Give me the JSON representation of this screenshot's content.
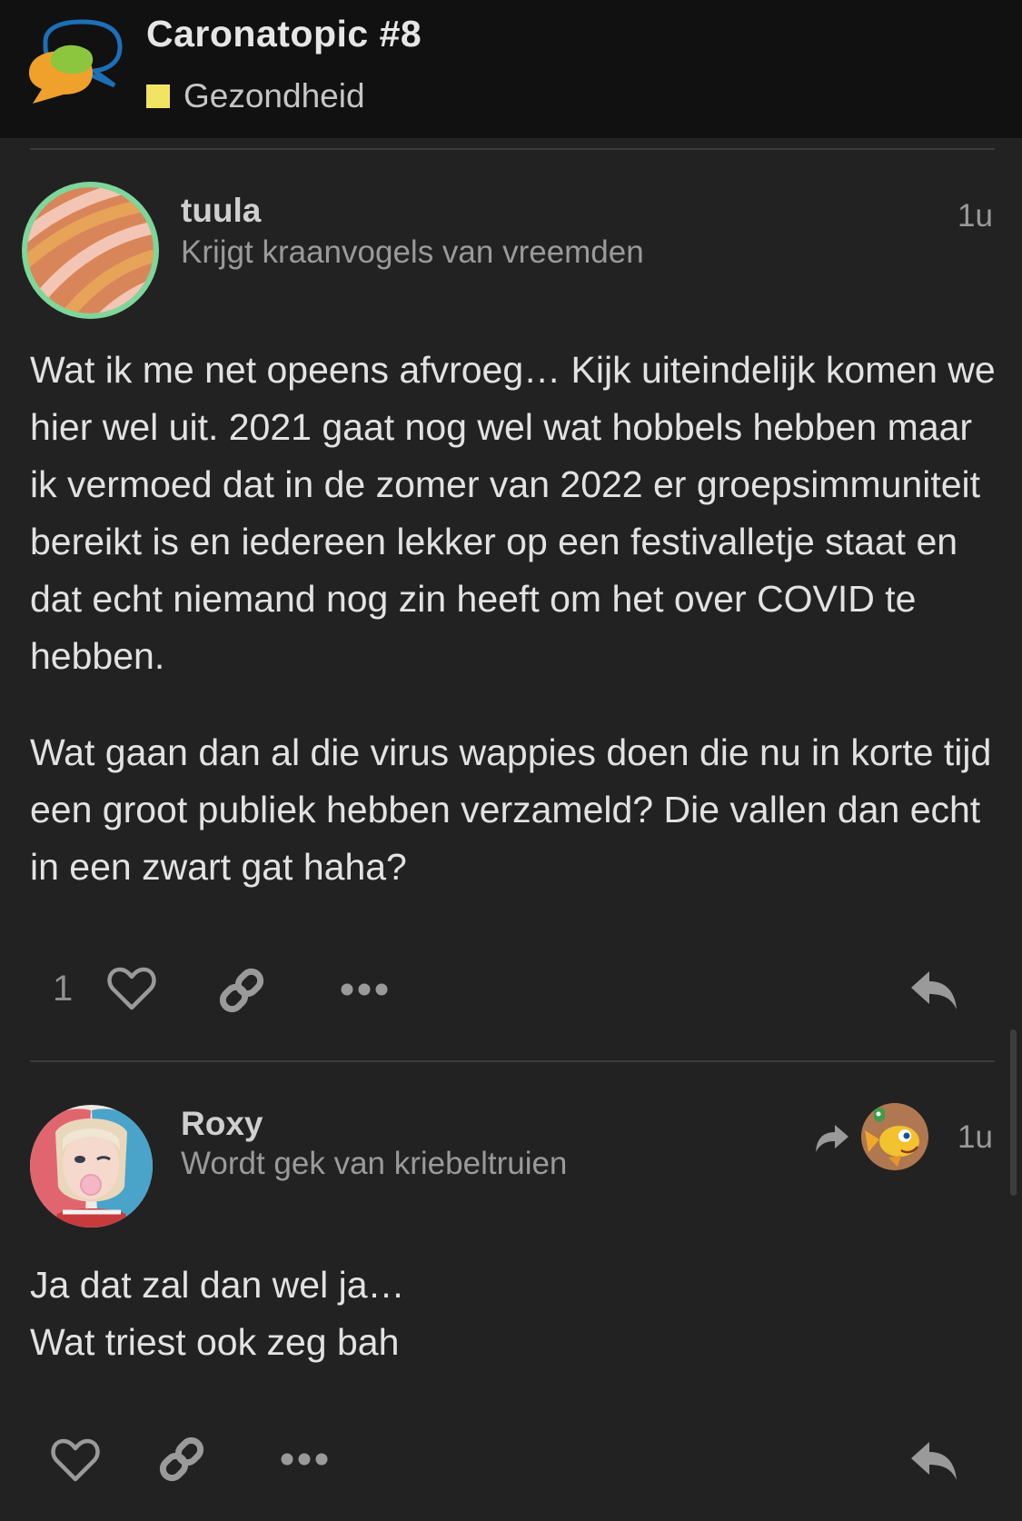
{
  "header": {
    "topic_title": "Caronatopic #8",
    "category": "Gezondheid",
    "category_color": "#f1e464"
  },
  "posts": [
    {
      "username": "tuula",
      "user_title": "Krijgt kraanvogels van vreemden",
      "age": "1u",
      "avatar_icon": "striped-avatar",
      "paragraphs": [
        "Wat ik me net opeens afvroeg… Kijk uiteindelijk komen we hier wel uit. 2021 gaat nog wel wat hobbels hebben maar ik vermoed dat in de zomer van 2022 er groepsimmuniteit bereikt is en iedereen lekker op een festivalletje staat en dat echt niemand nog zin heeft om het over COVID te hebben.",
        "Wat gaan dan al die virus wappies doen die nu in korte tijd een groot publiek hebben verzameld? Die vallen dan echt in een zwart gat haha?"
      ],
      "like_count": "1"
    },
    {
      "username": "Roxy",
      "user_title": "Wordt gek van kriebeltruien",
      "age": "1u",
      "avatar_icon": "harley-quinn-avatar",
      "reply_to_icon": "cartoon-fish-avatar",
      "paragraphs": [
        "Ja dat zal dan wel ja…",
        "Wat triest ook zeg bah"
      ]
    }
  ],
  "colors": {
    "background": "#222222",
    "header_bg": "#111111",
    "avatar_ring": "#7ed69a",
    "icon_gray": "#9a9a9a"
  }
}
